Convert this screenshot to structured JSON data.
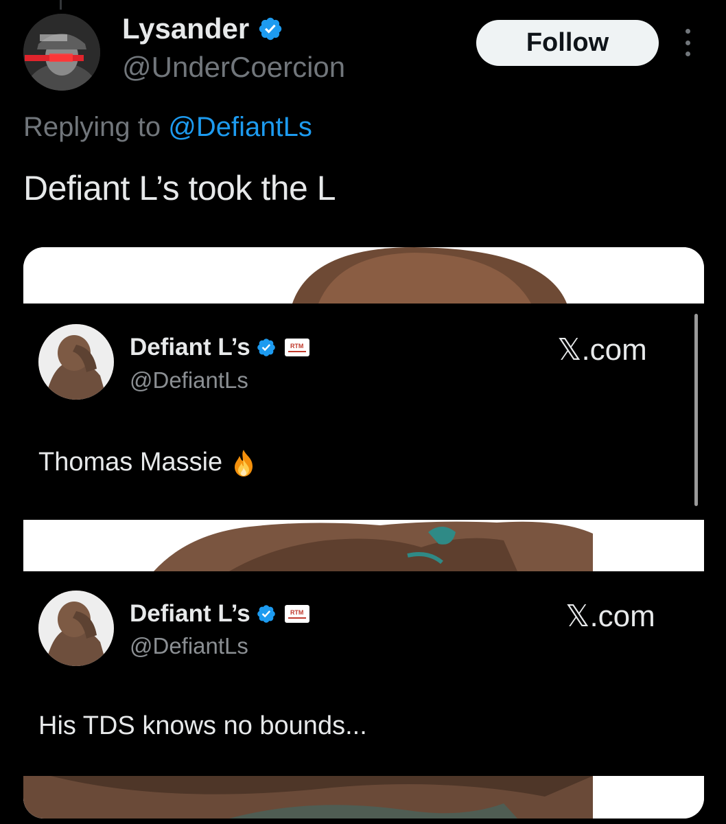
{
  "author": {
    "display_name": "Lysander",
    "handle": "@UnderCoercion",
    "verified": true
  },
  "actions": {
    "follow_label": "Follow"
  },
  "reply": {
    "prefix": "Replying to ",
    "mention": "@DefiantLs"
  },
  "tweet": {
    "text": "Defiant L’s took the L"
  },
  "media": {
    "embeds": [
      {
        "display_name": "Defiant L’s",
        "handle": "@DefiantLs",
        "site": "𝕏.com",
        "text": "Thomas Massie",
        "emoji": "fire-icon",
        "affiliate_badge": "RTM"
      },
      {
        "display_name": "Defiant L’s",
        "handle": "@DefiantLs",
        "site": "𝕏.com",
        "text": "His TDS knows no bounds...",
        "affiliate_badge": "RTM"
      }
    ]
  },
  "colors": {
    "background": "#000000",
    "primary_text": "#e7e9ea",
    "secondary_text": "#71767b",
    "link": "#1d9bf0",
    "verified": "#1d9bf0",
    "follow_bg": "#eff3f4"
  },
  "icons": {
    "verified": "verified-badge-icon",
    "more": "more-options-icon"
  }
}
